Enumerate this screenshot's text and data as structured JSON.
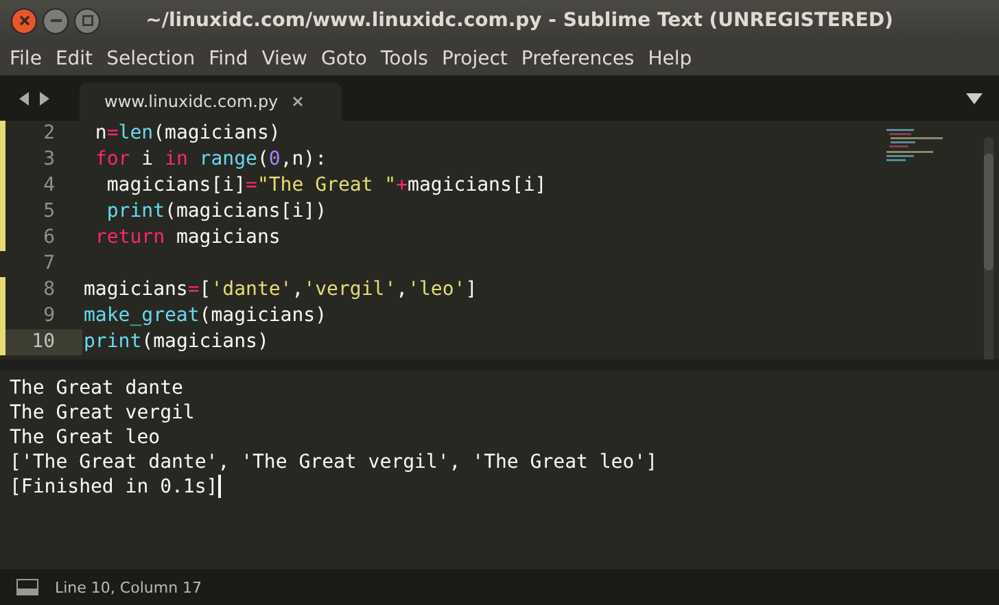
{
  "window": {
    "title": "~/linuxidc.com/www.linuxidc.com.py - Sublime Text (UNREGISTERED)"
  },
  "menu": [
    "File",
    "Edit",
    "Selection",
    "Find",
    "View",
    "Goto",
    "Tools",
    "Project",
    "Preferences",
    "Help"
  ],
  "tabs": [
    {
      "label": "www.linuxidc.com.py",
      "selected": true
    }
  ],
  "editor": {
    "lines": [
      {
        "number": "2",
        "current": false,
        "modified": true,
        "tokens": [
          {
            "t": " n",
            "kind": "plain"
          },
          {
            "t": "=",
            "kind": "operator"
          },
          {
            "t": "len",
            "kind": "function"
          },
          {
            "t": "(magicians)",
            "kind": "plain"
          }
        ]
      },
      {
        "number": "3",
        "current": false,
        "modified": true,
        "tokens": [
          {
            "t": " for",
            "kind": "keyword"
          },
          {
            "t": " i ",
            "kind": "plain"
          },
          {
            "t": "in",
            "kind": "keyword"
          },
          {
            "t": " range",
            "kind": "function"
          },
          {
            "t": "(",
            "kind": "plain"
          },
          {
            "t": "0",
            "kind": "number"
          },
          {
            "t": ",n):",
            "kind": "plain"
          }
        ]
      },
      {
        "number": "4",
        "current": false,
        "modified": true,
        "tokens": [
          {
            "t": "  magicians[i]",
            "kind": "plain"
          },
          {
            "t": "=",
            "kind": "operator"
          },
          {
            "t": "\"The Great \"",
            "kind": "string"
          },
          {
            "t": "+",
            "kind": "operator"
          },
          {
            "t": "magicians[i]",
            "kind": "plain"
          }
        ]
      },
      {
        "number": "5",
        "current": false,
        "modified": true,
        "tokens": [
          {
            "t": "  print",
            "kind": "function"
          },
          {
            "t": "(magicians[i])",
            "kind": "plain"
          }
        ]
      },
      {
        "number": "6",
        "current": false,
        "modified": true,
        "tokens": [
          {
            "t": " return",
            "kind": "keyword"
          },
          {
            "t": " magicians",
            "kind": "plain"
          }
        ]
      },
      {
        "number": "7",
        "current": false,
        "modified": false
      },
      {
        "number": "8",
        "current": false,
        "modified": true,
        "tokens": [
          {
            "t": "magicians",
            "kind": "plain"
          },
          {
            "t": "=",
            "kind": "operator"
          },
          {
            "t": "[",
            "kind": "plain"
          },
          {
            "t": "'dante'",
            "kind": "string"
          },
          {
            "t": ",",
            "kind": "plain"
          },
          {
            "t": "'vergil'",
            "kind": "string"
          },
          {
            "t": ",",
            "kind": "plain"
          },
          {
            "t": "'leo'",
            "kind": "string"
          },
          {
            "t": "]",
            "kind": "plain"
          }
        ]
      },
      {
        "number": "9",
        "current": false,
        "modified": true,
        "tokens": [
          {
            "t": "make_great",
            "kind": "function"
          },
          {
            "t": "(magicians)",
            "kind": "plain"
          }
        ]
      },
      {
        "number": "10",
        "current": true,
        "modified": true,
        "tokens": [
          {
            "t": "print",
            "kind": "function"
          },
          {
            "t": "(magicians)",
            "kind": "plain"
          }
        ]
      }
    ]
  },
  "output": [
    "The Great dante",
    "The Great vergil",
    "The Great leo",
    "['The Great dante', 'The Great vergil', 'The Great leo']",
    "[Finished in 0.1s]"
  ],
  "status_bar": {
    "text": "Line 10, Column 17"
  }
}
